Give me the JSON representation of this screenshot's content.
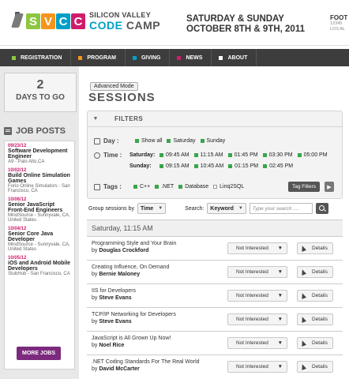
{
  "header": {
    "logo_letters": [
      "S",
      "V",
      "C",
      "C"
    ],
    "logo_line1": "SILICON VALLEY",
    "logo_code": "CODE",
    "logo_camp": " CAMP",
    "date_line1": "SATURDAY & SUNDAY",
    "date_line2": "OCTOBER 8TH & 9TH, 2011",
    "foot_label": "FOOT",
    "foot_line2": "12345",
    "foot_line3": "LOS AL"
  },
  "nav": {
    "items": [
      {
        "label": "REGISTRATION",
        "color": "#8ec63f"
      },
      {
        "label": "PROGRAM",
        "color": "#f7941d"
      },
      {
        "label": "GIVING",
        "color": "#00a0c6"
      },
      {
        "label": "NEWS",
        "color": "#d01d6a"
      },
      {
        "label": "ABOUT",
        "color": "#ffffff"
      }
    ]
  },
  "countdown": {
    "number": "2",
    "label": "DAYS TO GO"
  },
  "jobs": {
    "title": "JOB POSTS",
    "items": [
      {
        "date": "09/23/12",
        "title": "Software Development Engineer",
        "company": "A9 - Palo Alto,CA"
      },
      {
        "date": "10/02/12",
        "title": "Build Online Simulation Games",
        "company": "Forio Online Simulators - San Francisco, CA"
      },
      {
        "date": "10/06/12",
        "title": "Senior JavaScript Front-End Engineers",
        "company": "MindSource - Sunnyvale, CA, United States"
      },
      {
        "date": "10/04/12",
        "title": "Senior Core Java Developer",
        "company": "MindSource - Sunnyvale, CA, United States"
      },
      {
        "date": "10/05/12",
        "title": "iOS and Android Mobile Developers",
        "company": "StubHub - San Francisco, CA"
      }
    ],
    "more_label": "MORE JOBS"
  },
  "main": {
    "advanced_mode": "Advanced Mode",
    "title": "SESSIONS",
    "filters": {
      "heading": "FILTERS",
      "day_label": "Day :",
      "day_options": [
        {
          "label": "Show all",
          "checked": true
        },
        {
          "label": "Saturday",
          "checked": true
        },
        {
          "label": "Sunday",
          "checked": true
        }
      ],
      "time_label": "Time :",
      "saturday_label": "Saturday:",
      "saturday_times": [
        "09:45 AM",
        "11:15 AM",
        "01:45 PM",
        "03:30 PM",
        "05:00 PM"
      ],
      "sunday_label": "Sunday:",
      "sunday_times": [
        "09:15 AM",
        "10:45 AM",
        "01:15 PM",
        "02:45 PM"
      ],
      "tags_label": "Tags :",
      "tags": [
        {
          "label": "C++",
          "checked": true
        },
        {
          "label": ".NET",
          "checked": true
        },
        {
          "label": "Database",
          "checked": true
        },
        {
          "label": "Linq2SQL",
          "checked": false
        }
      ],
      "tag_filters_button": "Tag Filters"
    },
    "group_label": "Group sessions by",
    "group_value": "Time",
    "search_label": "Search:",
    "search_type": "Keyword",
    "search_placeholder": "Type your search ....",
    "slot_heading": "Saturday, 11:15 AM",
    "interest_label": "Not Interested",
    "details_label": "Details",
    "sessions": [
      {
        "title": "Programming Style and Your Brain",
        "by": "by",
        "speaker": "Douglas Crockford"
      },
      {
        "title": "Creating Influence, On Demand",
        "by": "by",
        "speaker": "Bernie Maloney"
      },
      {
        "title": "IIS for Developers",
        "by": "by",
        "speaker": "Steve Evans"
      },
      {
        "title": "TCP/IP Networking for Developers",
        "by": "by",
        "speaker": "Steve Evans"
      },
      {
        "title": "JavaScript is All Grown Up Now!",
        "by": "by",
        "speaker": "Noel Rice"
      },
      {
        "title": ".NET Coding Standards For The Real World",
        "by": "by",
        "speaker": "David McCarter"
      }
    ]
  }
}
